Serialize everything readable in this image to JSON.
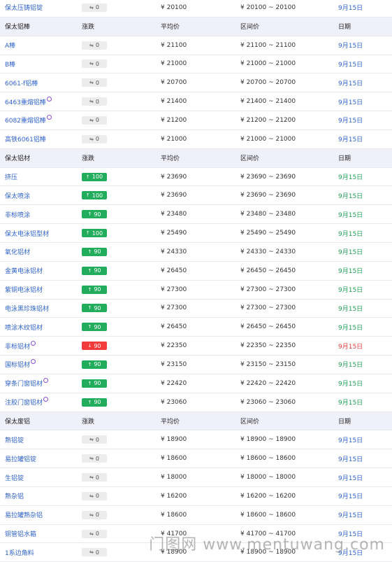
{
  "watermark": "门图网 www.mentuwang.com",
  "rows": [
    {
      "type": "data",
      "name": "保太压铸铝锭",
      "chg": "0",
      "dir": "flat",
      "avg": "¥ 20100",
      "range": "¥ 20100 ~ 20100",
      "date": "9月15日"
    },
    {
      "type": "hdr",
      "name": "保太铝棒",
      "chg": "涨跌",
      "avg": "平均价",
      "range": "区间价",
      "date": "日期"
    },
    {
      "type": "data",
      "name": "A棒",
      "chg": "0",
      "dir": "flat",
      "avg": "¥ 21100",
      "range": "¥ 21100 ~ 21100",
      "date": "9月15日"
    },
    {
      "type": "data",
      "name": "B棒",
      "chg": "0",
      "dir": "flat",
      "avg": "¥ 21000",
      "range": "¥ 21000 ~ 21000",
      "date": "9月15日"
    },
    {
      "type": "data",
      "name": "6061-f铝棒",
      "chg": "0",
      "dir": "flat",
      "avg": "¥ 20700",
      "range": "¥ 20700 ~ 20700",
      "date": "9月15日"
    },
    {
      "type": "data",
      "name": "6463重熔铝棒",
      "note": true,
      "chg": "0",
      "dir": "flat",
      "avg": "¥ 21400",
      "range": "¥ 21400 ~ 21400",
      "date": "9月15日"
    },
    {
      "type": "data",
      "name": "6082重熔铝棒",
      "note": true,
      "chg": "0",
      "dir": "flat",
      "avg": "¥ 21200",
      "range": "¥ 21200 ~ 21200",
      "date": "9月15日"
    },
    {
      "type": "data",
      "name": "高铁6061铝棒",
      "chg": "0",
      "dir": "flat",
      "avg": "¥ 21000",
      "range": "¥ 21000 ~ 21000",
      "date": "9月15日"
    },
    {
      "type": "hdr",
      "name": "保太铝材",
      "chg": "涨跌",
      "avg": "平均价",
      "range": "区间价",
      "date": "日期"
    },
    {
      "type": "data",
      "name": "挤压",
      "chg": "100",
      "dir": "up",
      "avg": "¥ 23690",
      "range": "¥ 23690 ~ 23690",
      "date": "9月15日"
    },
    {
      "type": "data",
      "name": "保太喷涂",
      "chg": "100",
      "dir": "up",
      "avg": "¥ 23690",
      "range": "¥ 23690 ~ 23690",
      "date": "9月15日"
    },
    {
      "type": "data",
      "name": "非标喷涂",
      "chg": "90",
      "dir": "up",
      "avg": "¥ 23480",
      "range": "¥ 23480 ~ 23480",
      "date": "9月15日"
    },
    {
      "type": "data",
      "name": "保太电泳铝型材",
      "chg": "100",
      "dir": "up",
      "avg": "¥ 25490",
      "range": "¥ 25490 ~ 25490",
      "date": "9月15日"
    },
    {
      "type": "data",
      "name": "氧化铝材",
      "chg": "90",
      "dir": "up",
      "avg": "¥ 24330",
      "range": "¥ 24330 ~ 24330",
      "date": "9月15日"
    },
    {
      "type": "data",
      "name": "金黄电泳铝材",
      "chg": "90",
      "dir": "up",
      "avg": "¥ 26450",
      "range": "¥ 26450 ~ 26450",
      "date": "9月15日"
    },
    {
      "type": "data",
      "name": "紫铜电泳铝材",
      "chg": "90",
      "dir": "up",
      "avg": "¥ 27300",
      "range": "¥ 27300 ~ 27300",
      "date": "9月15日"
    },
    {
      "type": "data",
      "name": "电泳黑珍珠铝材",
      "chg": "90",
      "dir": "up",
      "avg": "¥ 27300",
      "range": "¥ 27300 ~ 27300",
      "date": "9月15日"
    },
    {
      "type": "data",
      "name": "喷涂木纹铝材",
      "chg": "90",
      "dir": "up",
      "avg": "¥ 26450",
      "range": "¥ 26450 ~ 26450",
      "date": "9月15日"
    },
    {
      "type": "data",
      "name": "非标铝材",
      "note": true,
      "chg": "90",
      "dir": "down",
      "avg": "¥ 22350",
      "range": "¥ 22350 ~ 22350",
      "date": "9月15日"
    },
    {
      "type": "data",
      "name": "国标铝材",
      "note": true,
      "chg": "90",
      "dir": "up",
      "avg": "¥ 23150",
      "range": "¥ 23150 ~ 23150",
      "date": "9月15日"
    },
    {
      "type": "data",
      "name": "穿条门窗铝材",
      "note": true,
      "chg": "90",
      "dir": "up",
      "avg": "¥ 22420",
      "range": "¥ 22420 ~ 22420",
      "date": "9月15日"
    },
    {
      "type": "data",
      "name": "注胶门窗铝材",
      "note": true,
      "chg": "90",
      "dir": "up",
      "avg": "¥ 23060",
      "range": "¥ 23060 ~ 23060",
      "date": "9月15日"
    },
    {
      "type": "hdr",
      "name": "保太废铝",
      "chg": "涨跌",
      "avg": "平均价",
      "range": "区间价",
      "date": "日期"
    },
    {
      "type": "data",
      "name": "熟铝锭",
      "chg": "0",
      "dir": "flat",
      "avg": "¥ 18900",
      "range": "¥ 18900 ~ 18900",
      "date": "9月15日"
    },
    {
      "type": "data",
      "name": "易拉罐铝锭",
      "chg": "0",
      "dir": "flat",
      "avg": "¥ 18600",
      "range": "¥ 18600 ~ 18600",
      "date": "9月15日"
    },
    {
      "type": "data",
      "name": "生铝锭",
      "chg": "0",
      "dir": "flat",
      "avg": "¥ 18000",
      "range": "¥ 18000 ~ 18000",
      "date": "9月15日"
    },
    {
      "type": "data",
      "name": "熟杂铝",
      "chg": "0",
      "dir": "flat",
      "avg": "¥ 16200",
      "range": "¥ 16200 ~ 16200",
      "date": "9月15日"
    },
    {
      "type": "data",
      "name": "易拉罐熟杂铝",
      "chg": "0",
      "dir": "flat",
      "avg": "¥ 18600",
      "range": "¥ 18600 ~ 18600",
      "date": "9月15日"
    },
    {
      "type": "data",
      "name": "铜管铝水箱",
      "chg": "0",
      "dir": "flat",
      "avg": "¥ 41700",
      "range": "¥ 41700 ~ 41700",
      "date": "9月15日"
    },
    {
      "type": "data",
      "name": "1系边角料",
      "chg": "0",
      "dir": "flat",
      "avg": "¥ 18900",
      "range": "¥ 18900 ~ 18900",
      "date": "9月15日"
    }
  ]
}
